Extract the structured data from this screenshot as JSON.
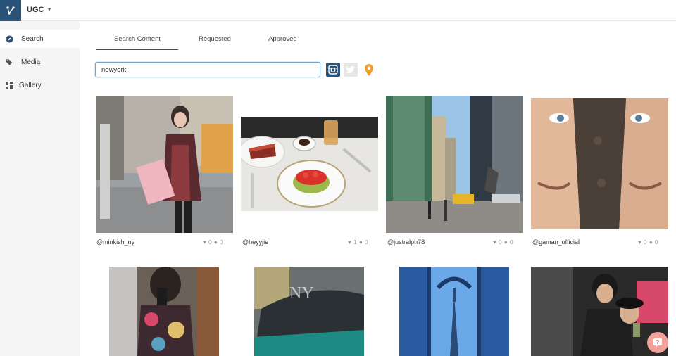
{
  "app": {
    "name": "UGC"
  },
  "sidebar": {
    "items": [
      {
        "label": "Search"
      },
      {
        "label": "Media"
      },
      {
        "label": "Gallery"
      }
    ]
  },
  "tabs": [
    {
      "label": "Search Content"
    },
    {
      "label": "Requested"
    },
    {
      "label": "Approved"
    }
  ],
  "search": {
    "value": "newyork"
  },
  "sources": [
    "instagram-icon",
    "twitter-icon",
    "location-pin-icon"
  ],
  "posts": [
    {
      "user": "@minkish_ny",
      "likes": "0",
      "comments": "0"
    },
    {
      "user": "@heyyjie",
      "likes": "1",
      "comments": "0"
    },
    {
      "user": "@justralph78",
      "likes": "0",
      "comments": "0"
    },
    {
      "user": "@gaman_official",
      "likes": "0",
      "comments": "0"
    }
  ],
  "colors": {
    "brand": "#2b5379",
    "accent_orange": "#f0a030",
    "search_border": "#6fa4cf"
  }
}
